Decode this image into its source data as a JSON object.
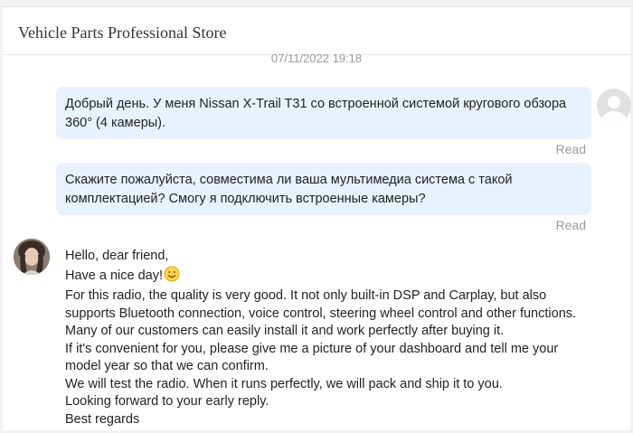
{
  "store": {
    "title": "Vehicle Parts Professional Store"
  },
  "conversation": {
    "timestamp": "07/11/2022 19:18",
    "messages": [
      {
        "sender": "user",
        "text_lines": [
          "Добрый день. У меня Nissan X-Trail T31 со встроенной системой кругового обзора",
          "360° (4 камеры)."
        ],
        "status": "Read"
      },
      {
        "sender": "user",
        "text_lines": [
          "Скажите пожалуйста, совместима ли ваша мультимедиа система с такой",
          "комплектацией? Смогу я подключить встроенные камеры?"
        ],
        "status": "Read"
      }
    ],
    "seller_reply": {
      "lines": [
        "Hello, dear friend,",
        "Have a nice day!",
        "For this radio, the quality is very good. It not only built-in DSP and Carplay, but also",
        "supports Bluetooth connection, voice control, steering wheel control and other functions.",
        "Many of our customers can easily install it and work perfectly after buying it.",
        "If it's convenient for you, please give me a picture of your dashboard and tell me your",
        "model year so that we can confirm.",
        "We will test the radio. When it runs perfectly, we will pack and ship it to you.",
        "Looking forward to your early reply.",
        "Best regards"
      ],
      "emoji": "smiling-face-icon"
    }
  },
  "colors": {
    "bubble": "#e8f2ff",
    "muted": "#9a9a9a",
    "text": "#222222"
  }
}
